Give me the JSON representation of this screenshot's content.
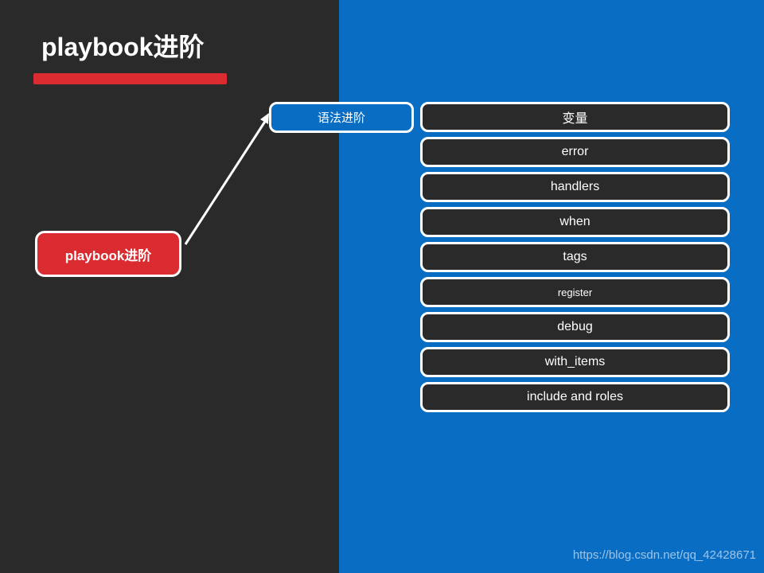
{
  "slide": {
    "title": "playbook进阶",
    "background_dark": "#2a2a2a",
    "background_blue": "#0a6dc4",
    "accent_red": "#d92b30"
  },
  "root_node": {
    "label": "playbook进阶"
  },
  "branch_node": {
    "label": "语法进阶"
  },
  "topics": [
    {
      "label": "变量",
      "size": "normal"
    },
    {
      "label": "error",
      "size": "normal"
    },
    {
      "label": "handlers",
      "size": "normal"
    },
    {
      "label": "when",
      "size": "normal"
    },
    {
      "label": "tags",
      "size": "normal"
    },
    {
      "label": "register",
      "size": "small"
    },
    {
      "label": "debug",
      "size": "normal"
    },
    {
      "label": "with_items",
      "size": "normal"
    },
    {
      "label": "include and roles",
      "size": "normal"
    }
  ],
  "watermark": {
    "text": "https://blog.csdn.net/qq_42428671"
  }
}
